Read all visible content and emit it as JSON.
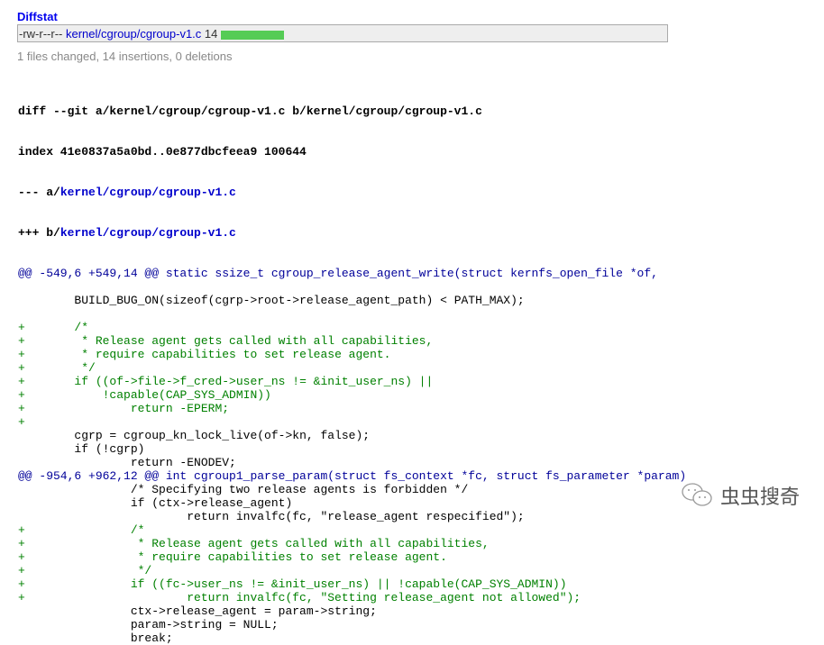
{
  "diffstat": {
    "title": "Diffstat",
    "mode": "-rw-r--r--",
    "file": "kernel/cgroup/cgroup-v1.c",
    "count": "14",
    "summary": "1 files changed, 14 insertions, 0 deletions"
  },
  "header": {
    "diff_prefix": "diff --git a/kernel/cgroup/cgroup-v1.c b/kernel/cgroup/cgroup-v1.c",
    "index": "index 41e0837a5a0bd..0e877dbcfeea9 100644",
    "minus_prefix": "--- a/",
    "plus_prefix": "+++ b/",
    "file": "kernel/cgroup/cgroup-v1.c"
  },
  "lines": [
    {
      "t": "hunk",
      "s": "@@ -549,6 +549,14 @@ static ssize_t cgroup_release_agent_write(struct kernfs_open_file *of,"
    },
    {
      "t": "ctx",
      "s": " "
    },
    {
      "t": "ctx",
      "s": " \tBUILD_BUG_ON(sizeof(cgrp->root->release_agent_path) < PATH_MAX);"
    },
    {
      "t": "ctx",
      "s": " "
    },
    {
      "t": "add",
      "s": "+\t/*"
    },
    {
      "t": "add",
      "s": "+\t * Release agent gets called with all capabilities,"
    },
    {
      "t": "add",
      "s": "+\t * require capabilities to set release agent."
    },
    {
      "t": "add",
      "s": "+\t */"
    },
    {
      "t": "add",
      "s": "+\tif ((of->file->f_cred->user_ns != &init_user_ns) ||"
    },
    {
      "t": "add",
      "s": "+\t    !capable(CAP_SYS_ADMIN))"
    },
    {
      "t": "add",
      "s": "+\t\treturn -EPERM;"
    },
    {
      "t": "add",
      "s": "+"
    },
    {
      "t": "ctx",
      "s": " \tcgrp = cgroup_kn_lock_live(of->kn, false);"
    },
    {
      "t": "ctx",
      "s": " \tif (!cgrp)"
    },
    {
      "t": "ctx",
      "s": " \t\treturn -ENODEV;"
    },
    {
      "t": "hunk",
      "s": "@@ -954,6 +962,12 @@ int cgroup1_parse_param(struct fs_context *fc, struct fs_parameter *param)"
    },
    {
      "t": "ctx",
      "s": " \t\t/* Specifying two release agents is forbidden */"
    },
    {
      "t": "ctx",
      "s": " \t\tif (ctx->release_agent)"
    },
    {
      "t": "ctx",
      "s": " \t\t\treturn invalfc(fc, \"release_agent respecified\");"
    },
    {
      "t": "add",
      "s": "+\t\t/*"
    },
    {
      "t": "add",
      "s": "+\t\t * Release agent gets called with all capabilities,"
    },
    {
      "t": "add",
      "s": "+\t\t * require capabilities to set release agent."
    },
    {
      "t": "add",
      "s": "+\t\t */"
    },
    {
      "t": "add",
      "s": "+\t\tif ((fc->user_ns != &init_user_ns) || !capable(CAP_SYS_ADMIN))"
    },
    {
      "t": "add",
      "s": "+\t\t\treturn invalfc(fc, \"Setting release_agent not allowed\");"
    },
    {
      "t": "ctx",
      "s": " \t\tctx->release_agent = param->string;"
    },
    {
      "t": "ctx",
      "s": " \t\tparam->string = NULL;"
    },
    {
      "t": "ctx",
      "s": " \t\tbreak;"
    }
  ],
  "watermark": {
    "text": "虫虫搜奇"
  },
  "colors": {
    "bar": "#55cc55",
    "add": "#008000",
    "hunk": "#000099",
    "link": "#0000cc"
  }
}
